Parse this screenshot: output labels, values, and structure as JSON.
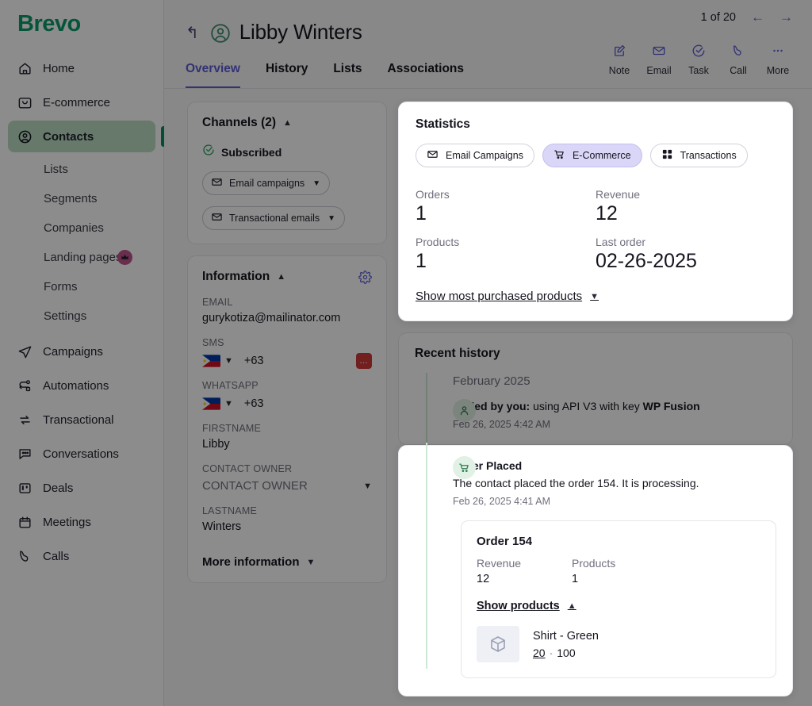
{
  "brand": {
    "name": "Brevo",
    "color": "#0b996e"
  },
  "sidebar": {
    "items": [
      {
        "label": "Home",
        "icon": "home-icon"
      },
      {
        "label": "E-commerce",
        "icon": "shopping-bag-icon"
      },
      {
        "label": "Contacts",
        "icon": "contact-person-icon",
        "active": true
      },
      {
        "label": "Campaigns",
        "icon": "paper-plane-icon"
      },
      {
        "label": "Automations",
        "icon": "automation-flow-icon"
      },
      {
        "label": "Transactional",
        "icon": "exchange-arrows-icon"
      },
      {
        "label": "Conversations",
        "icon": "chat-bubble-icon"
      },
      {
        "label": "Deals",
        "icon": "board-columns-icon"
      },
      {
        "label": "Meetings",
        "icon": "calendar-icon"
      },
      {
        "label": "Calls",
        "icon": "phone-icon"
      }
    ],
    "sub_items": [
      {
        "label": "Lists"
      },
      {
        "label": "Segments"
      },
      {
        "label": "Companies"
      },
      {
        "label": "Landing pages",
        "badge": "crown-icon"
      },
      {
        "label": "Forms"
      },
      {
        "label": "Settings"
      }
    ]
  },
  "header": {
    "back_icon": "back-arrow-icon",
    "avatar_icon": "contact-avatar-icon",
    "contact_name": "Libby Winters",
    "pagination": {
      "label": "1 of 20",
      "prev_icon": "arrow-left-icon",
      "next_icon": "arrow-right-icon"
    },
    "actions": [
      {
        "label": "Note",
        "icon": "note-pencil-icon"
      },
      {
        "label": "Email",
        "icon": "envelope-icon"
      },
      {
        "label": "Task",
        "icon": "check-circle-icon"
      },
      {
        "label": "Call",
        "icon": "phone-handset-icon"
      },
      {
        "label": "More",
        "icon": "ellipsis-icon"
      }
    ],
    "tabs": [
      {
        "label": "Overview",
        "active": true
      },
      {
        "label": "History",
        "active": false
      },
      {
        "label": "Lists",
        "active": false
      },
      {
        "label": "Associations",
        "active": false
      }
    ]
  },
  "channels": {
    "title": "Channels (2)",
    "collapse_icon": "chevron-up-icon",
    "status": "Subscribed",
    "status_icon": "check-circle-green-icon",
    "pills": [
      {
        "label": "Email campaigns",
        "icon": "envelope-icon"
      },
      {
        "label": "Transactional emails",
        "icon": "envelope-icon"
      }
    ]
  },
  "information": {
    "title": "Information",
    "collapse_icon": "chevron-up-icon",
    "settings_icon": "gear-icon",
    "fields": [
      {
        "label": "EMAIL",
        "value": "gurykotiza@mailinator.com",
        "type": "text"
      },
      {
        "label": "SMS",
        "value": "+63",
        "type": "phone",
        "flag": "philippines-flag",
        "action_icon": "red-more-icon"
      },
      {
        "label": "WHATSAPP",
        "value": "+63",
        "type": "phone",
        "flag": "philippines-flag"
      },
      {
        "label": "FIRSTNAME",
        "value": "Libby",
        "type": "text"
      },
      {
        "label": "CONTACT OWNER",
        "value": "CONTACT OWNER",
        "type": "select"
      },
      {
        "label": "LASTNAME",
        "value": "Winters",
        "type": "text"
      }
    ],
    "more_label": "More information",
    "more_icon": "chevron-down-icon"
  },
  "statistics": {
    "title": "Statistics",
    "tabs": [
      {
        "label": "Email Campaigns",
        "icon": "envelope-icon",
        "selected": false
      },
      {
        "label": "E-Commerce",
        "icon": "shopping-cart-icon",
        "selected": true
      },
      {
        "label": "Transactions",
        "icon": "grid-squares-icon",
        "selected": false
      }
    ],
    "metrics": [
      {
        "label": "Orders",
        "value": "1"
      },
      {
        "label": "Revenue",
        "value": "12"
      },
      {
        "label": "Products",
        "value": "1"
      },
      {
        "label": "Last order",
        "value": "02-26-2025"
      }
    ],
    "show_link": "Show most purchased products",
    "show_link_icon": "chevron-down-icon"
  },
  "recent_history": {
    "title": "Recent history",
    "month": "February 2025",
    "events": [
      {
        "icon": "person-added-icon",
        "title_bold": "Added by you:",
        "title_rest": " using API V3 with key ",
        "title_bold2": "WP Fusion",
        "time": "Feb 26, 2025 4:42 AM"
      },
      {
        "icon": "shopping-cart-icon",
        "title_bold": "Order Placed",
        "description": "The contact placed the order 154. It is processing.",
        "time": "Feb 26, 2025 4:41 AM"
      }
    ]
  },
  "order_detail": {
    "order_number": "Order 154",
    "metrics": [
      {
        "label": "Revenue",
        "value": "12"
      },
      {
        "label": "Products",
        "value": "1"
      }
    ],
    "show_products_label": "Show products",
    "show_products_icon": "chevron-up-icon",
    "products": [
      {
        "thumb_icon": "package-box-icon",
        "name": "Shirt - Green",
        "qty": "20",
        "separator": "·",
        "price": "100"
      }
    ]
  }
}
